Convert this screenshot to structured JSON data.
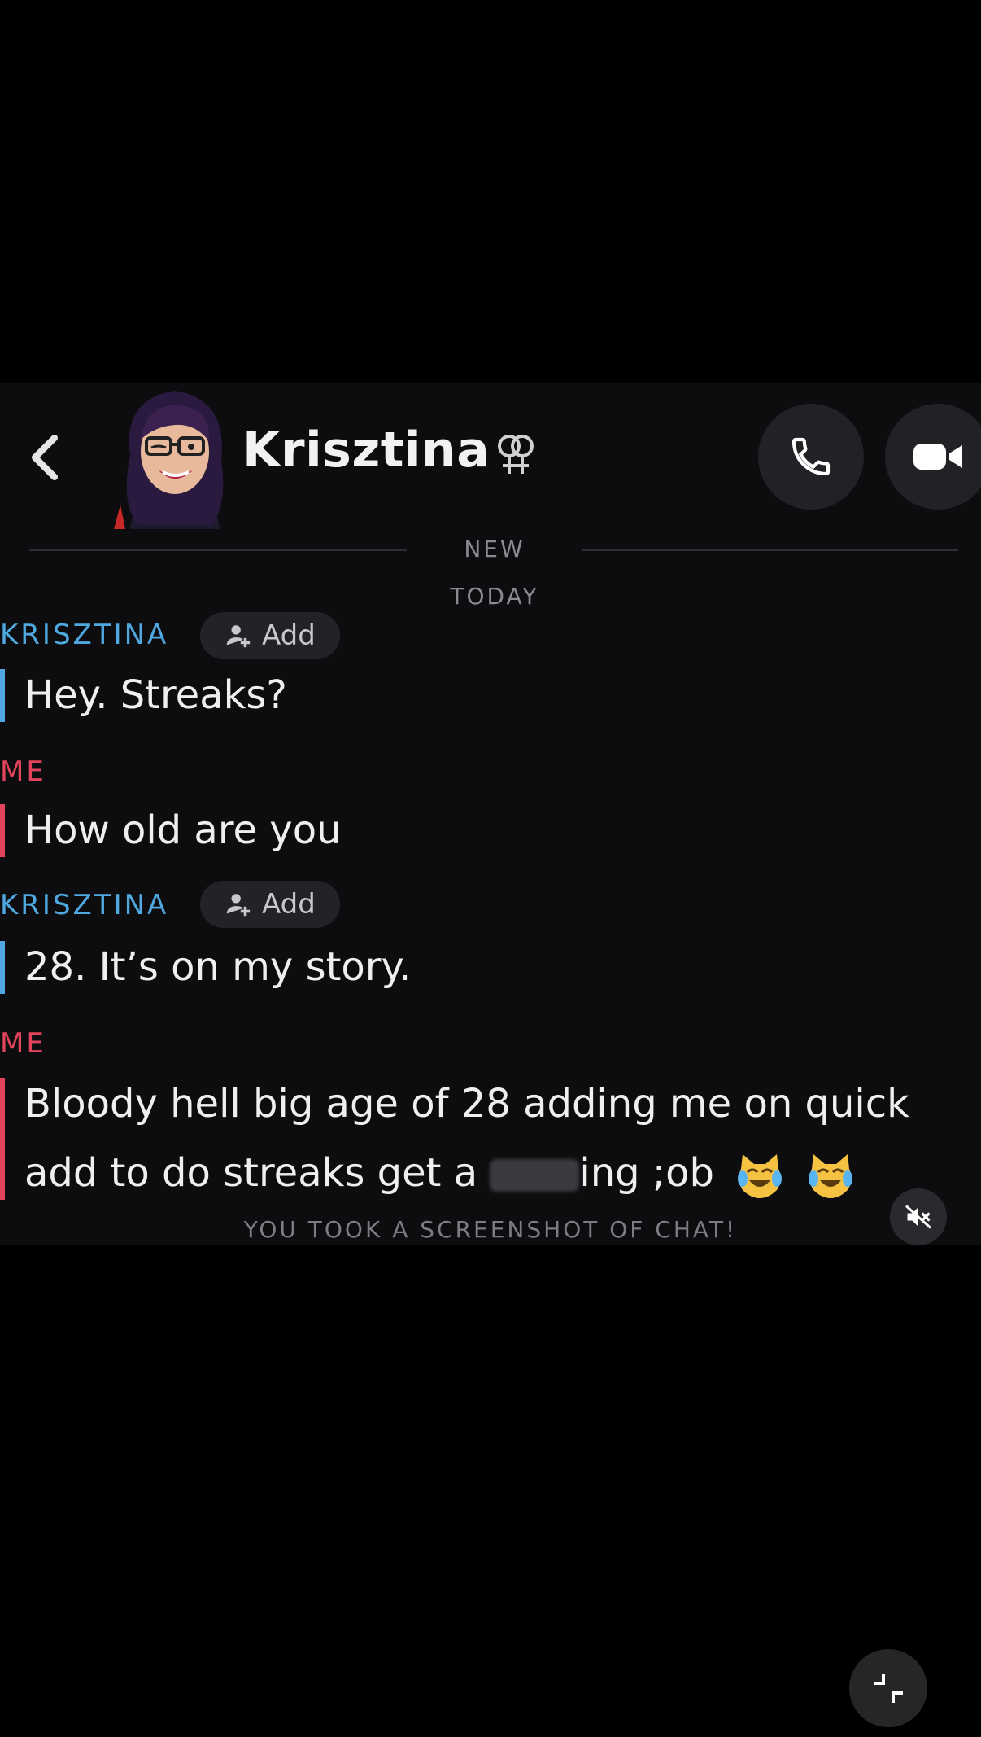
{
  "header": {
    "contact_name": "Krisztina",
    "back_icon": "chevron-left-icon",
    "gender_icon": "female-female-icon",
    "call_icon": "phone-icon",
    "video_icon": "video-camera-icon"
  },
  "separators": {
    "new_label": "NEW",
    "today_label": "TODAY"
  },
  "messages": [
    {
      "sender": "KRISZTINA",
      "role": "them",
      "add_label": "Add",
      "text": "Hey. Streaks?"
    },
    {
      "sender": "ME",
      "role": "me",
      "text": "How old are you"
    },
    {
      "sender": "KRISZTINA",
      "role": "them",
      "add_label": "Add",
      "text": "28. It’s on my story."
    },
    {
      "sender": "ME",
      "role": "me",
      "line1": "Bloody hell big age of 28 adding me on quick",
      "line2_before": "add to do streaks get a",
      "line2_after": "ing ;ob"
    }
  ],
  "notice": "YOU TOOK A SCREENSHOT OF CHAT!",
  "controls": {
    "mute_icon": "muted-speaker-icon",
    "minimize_icon": "exit-fullscreen-icon"
  },
  "colors": {
    "them_accent": "#4fa8e0",
    "me_accent": "#e2445c",
    "chat_background": "#0d0d0f"
  }
}
